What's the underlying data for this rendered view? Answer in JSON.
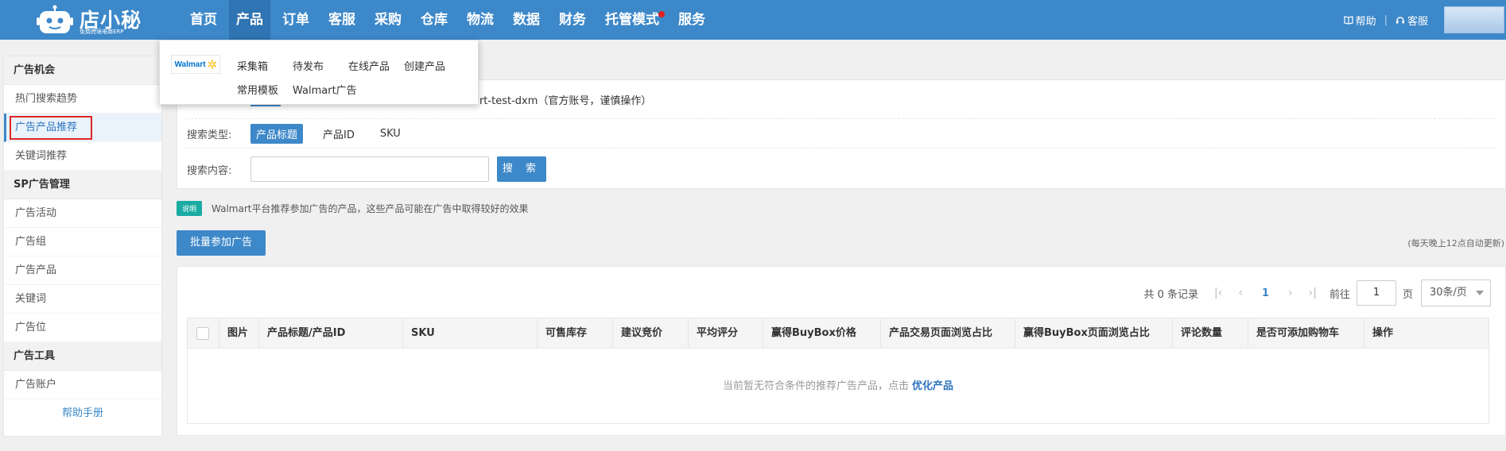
{
  "brand": {
    "name": "店小秘",
    "tagline": "免费跨境电商ERP"
  },
  "nav": [
    {
      "label": "首页"
    },
    {
      "label": "产品"
    },
    {
      "label": "订单"
    },
    {
      "label": "客服"
    },
    {
      "label": "采购"
    },
    {
      "label": "仓库"
    },
    {
      "label": "物流"
    },
    {
      "label": "数据"
    },
    {
      "label": "财务"
    },
    {
      "label": "托管模式"
    },
    {
      "label": "服务"
    }
  ],
  "top_right": {
    "help": "帮助",
    "service": "客服"
  },
  "dropdown": {
    "logo_text": "Walmart",
    "links": [
      "采集箱",
      "待发布",
      "在线产品",
      "创建产品",
      "常用模板",
      "Walmart广告"
    ]
  },
  "sidebar": {
    "groups": [
      {
        "title": "广告机会",
        "items": [
          "热门搜索趋势",
          "广告产品推荐",
          "关键词推荐"
        ]
      },
      {
        "title": "SP广告管理",
        "items": [
          "广告活动",
          "广告组",
          "广告产品",
          "关键词",
          "广告位"
        ]
      },
      {
        "title": "广告工具",
        "items": [
          "广告账户"
        ]
      }
    ],
    "help": "帮助手册"
  },
  "filters": {
    "account_text": "art-test-dxm（官方账号，谨慎操作）",
    "search_type_label": "搜索类型:",
    "search_types": [
      "产品标题",
      "产品ID",
      "SKU"
    ],
    "search_content_label": "搜索内容:",
    "search_input_value": "",
    "search_button": "搜 索"
  },
  "note": {
    "badge": "说明",
    "text": "Walmart平台推荐参加广告的产品，这些产品可能在广告中取得较好的效果"
  },
  "batch_button": "批量参加广告",
  "auto_note": "(每天晚上12点自动更新)",
  "pager": {
    "total_text": "共 0 条记录",
    "current_page": "1",
    "goto_label": "前往",
    "goto_value": "1",
    "page_unit": "页",
    "page_size": "30条/页"
  },
  "table": {
    "columns": [
      "图片",
      "产品标题/产品ID",
      "SKU",
      "可售库存",
      "建议竞价",
      "平均评分",
      "赢得BuyBox价格",
      "产品交易页面浏览占比",
      "赢得BuyBox页面浏览占比",
      "评论数量",
      "是否可添加购物车",
      "操作"
    ],
    "empty_text": "当前暂无符合条件的推荐广告产品，点击",
    "empty_link": "优化产品"
  },
  "colors": {
    "brand_blue": "#3d88c9",
    "teal": "#1aaba3",
    "highlight_red": "#e02525"
  }
}
